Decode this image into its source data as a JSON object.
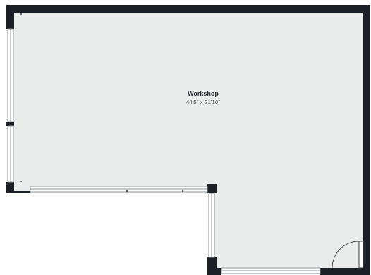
{
  "room": {
    "name": "Workshop",
    "dimensions": "44'5\" x 21'10\""
  },
  "colors": {
    "floor": "#ebecec",
    "wall": "#1b1f26",
    "window": "#ffffff",
    "window_line": "#8f9296",
    "door_swing": "#3a3d42"
  }
}
